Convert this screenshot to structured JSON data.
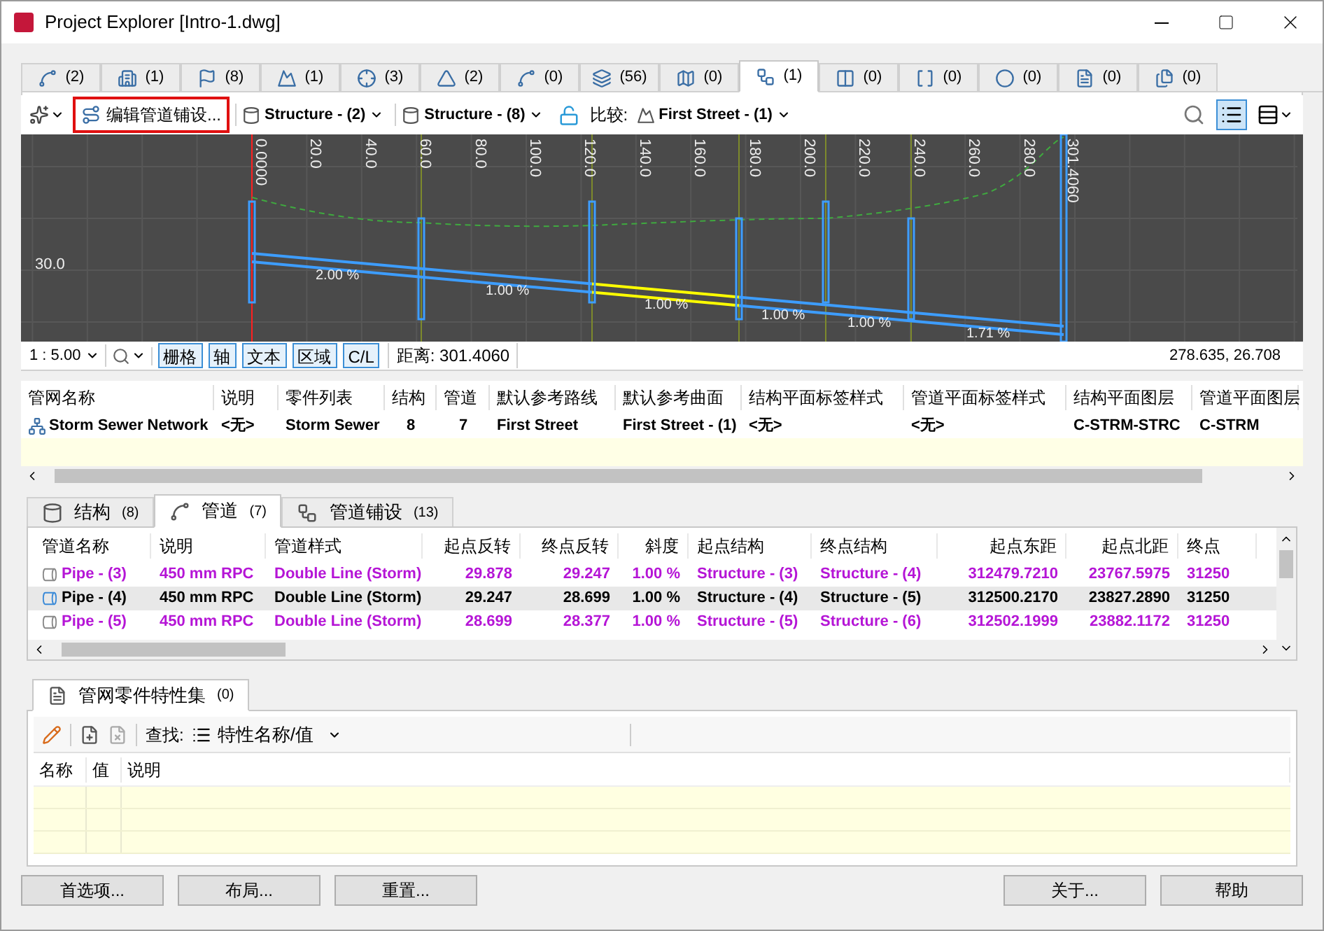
{
  "window": {
    "title": "Project Explorer [Intro-1.dwg]"
  },
  "object_tabs": [
    {
      "count": "(2)",
      "selected": false
    },
    {
      "count": "(1)",
      "selected": false
    },
    {
      "count": "(8)",
      "selected": false
    },
    {
      "count": "(1)",
      "selected": false
    },
    {
      "count": "(3)",
      "selected": false
    },
    {
      "count": "(2)",
      "selected": false
    },
    {
      "count": "(0)",
      "selected": false
    },
    {
      "count": "(56)",
      "selected": false
    },
    {
      "count": "(0)",
      "selected": false
    },
    {
      "count": "(1)",
      "selected": true
    },
    {
      "count": "(0)",
      "selected": false
    },
    {
      "count": "(0)",
      "selected": false
    },
    {
      "count": "(0)",
      "selected": false
    },
    {
      "count": "(0)",
      "selected": false
    },
    {
      "count": "(0)",
      "selected": false
    }
  ],
  "toolbar": {
    "edit_button": {
      "label": "编辑管道铺设...",
      "highlighted": true
    },
    "structure_dropdowns": [
      "Structure - (2)",
      "Structure - (8)"
    ],
    "compare_label": "比较:",
    "compare_value": "First Street - (1)",
    "views": [
      {
        "selected": true
      },
      {
        "selected": false
      }
    ]
  },
  "profile": {
    "stations": [
      "0.0000",
      "20.0",
      "40.0",
      "60.0",
      "80.0",
      "100.0",
      "120.0",
      "140.0",
      "160.0",
      "180.0",
      "200.0",
      "220.0",
      "240.0",
      "260.0",
      "280.0",
      "301.4060"
    ],
    "elevation_label": "30.0",
    "pipes": [
      {
        "slope": "2.00 %",
        "selected": false
      },
      {
        "slope": "1.00 %",
        "selected": false
      },
      {
        "slope": "1.00 %",
        "selected": true
      },
      {
        "slope": "1.00 %",
        "selected": false
      },
      {
        "slope": "1.00 %",
        "selected": false
      },
      {
        "slope": "1.71 %",
        "selected": false
      }
    ],
    "scale": "1 : 5.00",
    "toggles": [
      {
        "label": "栅格",
        "on": true
      },
      {
        "label": "轴",
        "on": true
      },
      {
        "label": "文本",
        "on": true
      },
      {
        "label": "区域",
        "on": true
      },
      {
        "label": "C/L",
        "on": true
      }
    ],
    "distance": "距离: 301.4060",
    "coordinates": "278.635, 26.708"
  },
  "network_table": {
    "columns": [
      "管网名称",
      "说明",
      "零件列表",
      "结构",
      "管道",
      "默认参考路线",
      "默认参考曲面",
      "结构平面标签样式",
      "管道平面标签样式",
      "结构平面图层",
      "管道平面图层"
    ],
    "rows": [
      [
        "Storm Sewer Network",
        "<无>",
        "Storm Sewer",
        "8",
        "7",
        "First Street",
        "First Street - (1)",
        "<无>",
        "<无>",
        "C-STRM-STRC",
        "C-STRM"
      ]
    ]
  },
  "detail_tabs": [
    {
      "label": "结构",
      "count": "(8)",
      "selected": false
    },
    {
      "label": "管道",
      "count": "(7)",
      "selected": true
    },
    {
      "label": "管道铺设",
      "count": "(13)",
      "selected": false
    }
  ],
  "pipe_table": {
    "columns": [
      "管道名称",
      "说明",
      "管道样式",
      "起点反转",
      "终点反转",
      "斜度",
      "起点结构",
      "终点结构",
      "起点东距",
      "起点北距",
      "终点"
    ],
    "rows": [
      {
        "selected": false,
        "cells": [
          "Pipe - (3)",
          "450 mm RPC",
          "Double Line (Storm)",
          "29.878",
          "29.247",
          "1.00 %",
          "Structure - (3)",
          "Structure - (4)",
          "312479.7210",
          "23767.5975",
          "31250"
        ]
      },
      {
        "selected": true,
        "cells": [
          "Pipe - (4)",
          "450 mm RPC",
          "Double Line (Storm)",
          "29.247",
          "28.699",
          "1.00 %",
          "Structure - (4)",
          "Structure - (5)",
          "312500.2170",
          "23827.2890",
          "31250"
        ]
      },
      {
        "selected": false,
        "cells": [
          "Pipe - (5)",
          "450 mm RPC",
          "Double Line (Storm)",
          "28.699",
          "28.377",
          "1.00 %",
          "Structure - (5)",
          "Structure - (6)",
          "312502.1999",
          "23882.1172",
          "31250"
        ]
      }
    ]
  },
  "property_panel": {
    "tab": {
      "label": "管网零件特性集",
      "count": "(0)"
    },
    "find_label": "查找:",
    "find_value": "特性名称/值",
    "columns": [
      "名称",
      "值",
      "说明"
    ]
  },
  "buttons_left": [
    "首选项...",
    "布局...",
    "重置..."
  ],
  "buttons_right": [
    "关于...",
    "帮助"
  ]
}
